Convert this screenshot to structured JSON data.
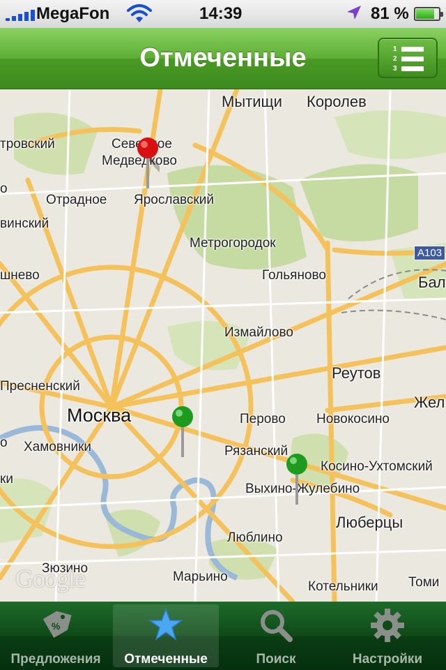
{
  "status_bar": {
    "carrier": "MegaFon",
    "time": "14:39",
    "battery_percent": "81 %",
    "battery_level": 0.81
  },
  "nav": {
    "title": "Отмеченные",
    "list_button_numbers": [
      "1",
      "2",
      "3"
    ]
  },
  "map": {
    "places": {
      "mytishchi": "Мытищи",
      "korolev": "Королев",
      "petrovsky": "тровский",
      "severnoe": "Северное",
      "medvedkovo": "Медведково",
      "otradnoe": "Отрадное",
      "yaroslavsky": "Ярославский",
      "vinsky": "винский",
      "metrogorodok": "Метрогородок",
      "shnevo": "шнево",
      "golyanovo": "Гольяново",
      "bal": "Бал",
      "izmaylovo": "Измайлово",
      "reutov": "Реутов",
      "presnensky": "Пресненский",
      "zhel": "Жел",
      "moskva": "Москва",
      "perovo": "Перово",
      "novokosino": "Новокосино",
      "khamovniki": "Хамовники",
      "ryazansky": "Рязанский",
      "kosino": "Косино-Ухтомский",
      "vykhino": "Выхино-Жулебино",
      "ki": "ки",
      "lyubertsy": "Люберцы",
      "lyublino": "Люблино",
      "zyuzino": "Зюзино",
      "maryino": "Марьино",
      "tomi": "Томи",
      "kotelniki": "Котельники",
      "o": "о"
    },
    "road_shield": "A103",
    "logo": "Google"
  },
  "tabs": [
    {
      "label": "Предложения",
      "icon": "tag-icon"
    },
    {
      "label": "Отмеченные",
      "icon": "star-icon"
    },
    {
      "label": "Поиск",
      "icon": "search-icon"
    },
    {
      "label": "Настройки",
      "icon": "gear-icon"
    }
  ],
  "colors": {
    "nav_green": "#5eae34",
    "tab_bar": "#0f4a18",
    "pin_red": "#d81010",
    "pin_green": "#1e9a1e",
    "road": "#f5c15a",
    "park": "#c6dba2"
  }
}
